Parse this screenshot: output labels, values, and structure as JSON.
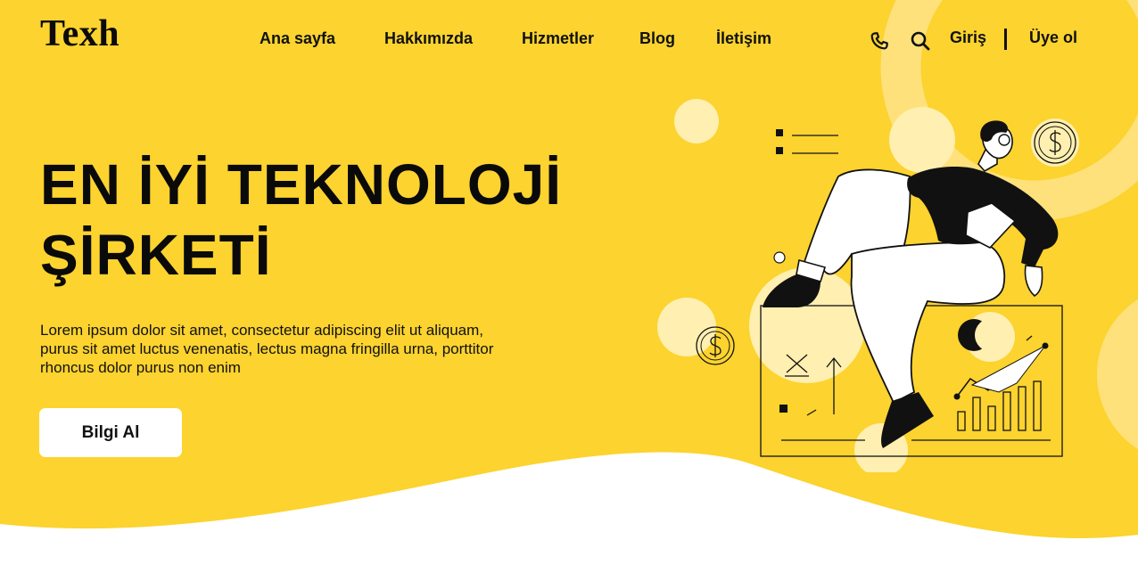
{
  "brand": {
    "logo": "Texh"
  },
  "nav": {
    "items": [
      {
        "label": "Ana sayfa"
      },
      {
        "label": "Hakkımızda"
      },
      {
        "label": "Hizmetler"
      },
      {
        "label": "Blog"
      },
      {
        "label": "İletişim"
      }
    ]
  },
  "actions": {
    "phone_icon": "phone-icon",
    "search_icon": "search-icon",
    "login_label": "Giriş",
    "signup_label": "Üye ol"
  },
  "hero": {
    "title_line1": "EN İYİ TEKNOLOJİ",
    "title_line2": "ŞİRKETİ",
    "description_line1": "Lorem ipsum dolor sit amet, consectetur adipiscing elit ut aliquam,",
    "description_line2": "purus sit amet luctus venenatis, lectus magna fringilla urna, porttitor",
    "description_line3": "rhoncus dolor purus non enim",
    "cta_label": "Bilgi Al"
  },
  "colors": {
    "brand_yellow": "#FCD32F",
    "light_yellow": "#FFE48A",
    "text_dark": "#0B0B0B",
    "white": "#FFFFFF"
  }
}
